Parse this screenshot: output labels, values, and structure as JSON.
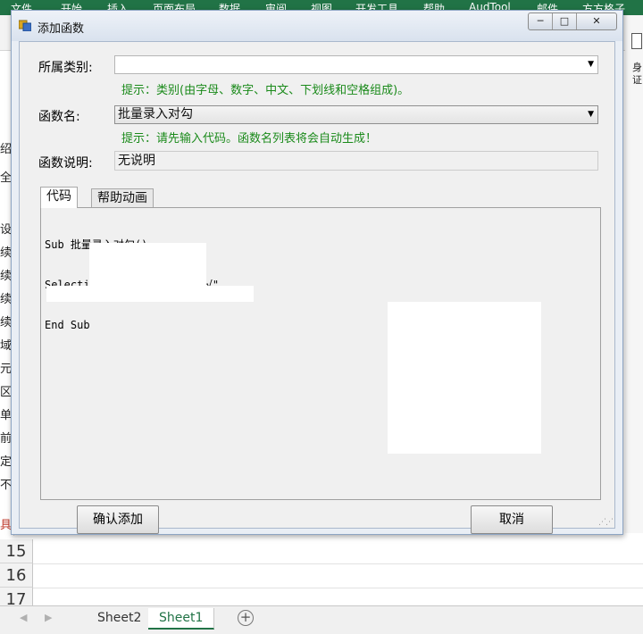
{
  "excel": {
    "ribbon_tabs": [
      "文件",
      "开始",
      "插入",
      "页面布局",
      "数据",
      "审阅",
      "视图",
      "开发工具",
      "帮助",
      "AudTool",
      "邮件",
      "方方格子"
    ],
    "left_column_chars": [
      "绍",
      "全",
      "设",
      "续",
      "续",
      "续",
      "续",
      "域",
      "元",
      "区",
      "单",
      "前",
      "定",
      "不",
      "具"
    ],
    "right_strip_chars": [
      "身",
      "证"
    ],
    "row_numbers": [
      "15",
      "16",
      "17"
    ],
    "sheet_nav": {
      "prev": "◀",
      "next": "▶"
    },
    "sheets": [
      "Sheet2",
      "Sheet1"
    ],
    "active_sheet": "Sheet1",
    "add_sheet": "+",
    "accent_color": "#217346"
  },
  "dialog": {
    "title": "添加函数",
    "window_buttons": {
      "minimize": "─",
      "maximize": "□",
      "close": "✕"
    },
    "category_label": "所属类别:",
    "category_value": "",
    "category_hint": "提示：类别(由字母、数字、中文、下划线和空格组成)。",
    "function_name_label": "函数名:",
    "function_name_value": "批量录入对勾",
    "function_name_hint": "提示：请先输入代码。函数名列表将会自动生成！",
    "description_label": "函数说明:",
    "description_value": "无说明",
    "tabs": [
      "代码",
      "帮助动画"
    ],
    "active_tab": "代码",
    "code_lines": [
      "Sub 批量录入对勾()",
      "Selection.FormulaR1C1 = \"√\"",
      "End Sub"
    ],
    "confirm_button": "确认添加",
    "cancel_button": "取消",
    "dropdown_arrow": "▼",
    "hint_color": "#1a8a1a"
  }
}
